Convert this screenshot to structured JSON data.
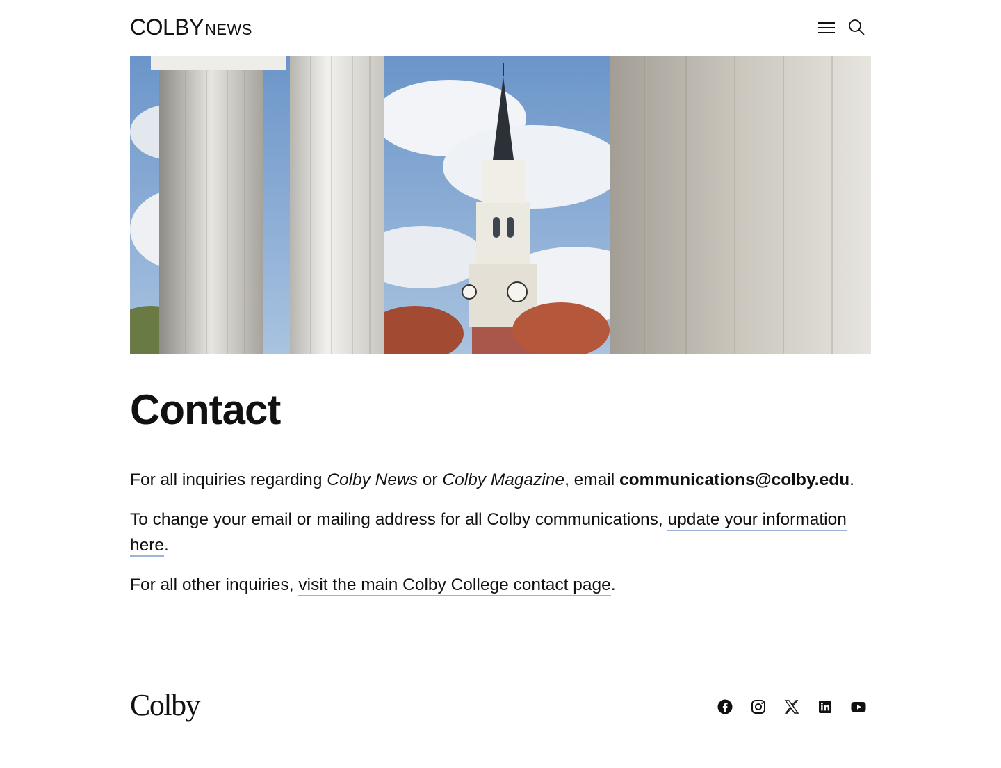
{
  "header": {
    "logo_main": "COLBY",
    "logo_sub": "NEWS",
    "menu_icon": "hamburger-menu-icon",
    "search_icon": "search-icon"
  },
  "hero": {
    "subject": "clock-tower-between-columns-photo"
  },
  "page": {
    "title": "Contact",
    "p1": {
      "t1": "For all inquiries regarding ",
      "pub1": "Colby News",
      "t2": " or ",
      "pub2": "Colby Magazine",
      "t3": ", email ",
      "email": "communications@colby.edu",
      "t4": "."
    },
    "p2": {
      "t1": "To change your email or mailing address for all Colby communications, ",
      "link": "update your information here",
      "t2": "."
    },
    "p3": {
      "t1": "For all other inquiries, ",
      "link": "visit the main Colby College contact page",
      "t2": "."
    }
  },
  "footer": {
    "logo": "Colby",
    "social_icons": [
      "facebook-icon",
      "instagram-icon",
      "x-icon",
      "linkedin-icon",
      "youtube-icon"
    ]
  },
  "colors": {
    "text": "#111111",
    "link_underline": "#9db4d6",
    "background": "#ffffff"
  }
}
